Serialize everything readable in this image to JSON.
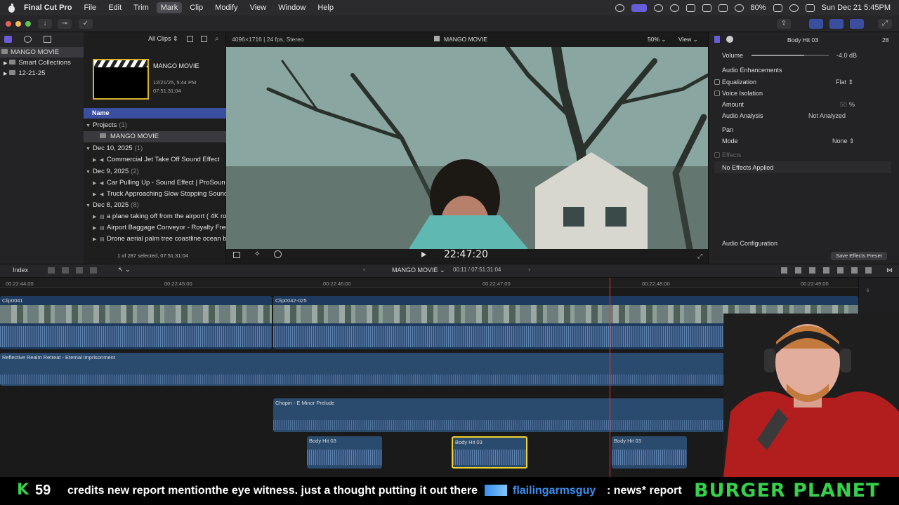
{
  "menubar": {
    "app": "Final Cut Pro",
    "items": [
      "File",
      "Edit",
      "Trim",
      "Mark",
      "Clip",
      "Modify",
      "View",
      "Window",
      "Help"
    ],
    "selected": "Mark",
    "battery": "80%",
    "datetime": "Sun Dec 21  5:45PM"
  },
  "library": {
    "items": [
      "MANGO MOVIE",
      "Smart Collections",
      "12-21-25"
    ]
  },
  "browser": {
    "filter": "All Clips",
    "project": {
      "title": "MANGO MOVIE",
      "date": "12/21/25, 5:44 PM",
      "duration": "07:51:31:04"
    },
    "col_header": "Name",
    "selection": "1 of 287 selected, 07:51:31:04",
    "groups": [
      {
        "label": "Projects",
        "count": "(1)",
        "items": [
          "MANGO MOVIE"
        ]
      },
      {
        "label": "Dec 10, 2025",
        "count": "(1)",
        "items": [
          "Commercial Jet Take Off Sound Effect"
        ]
      },
      {
        "label": "Dec 9, 2025",
        "count": "(2)",
        "items": [
          "Car Pulling Up - Sound Effect  |  ProSoun",
          "Truck Approaching Slow Stopping Sound"
        ]
      },
      {
        "label": "Dec 8, 2025",
        "count": "(8)",
        "items": [
          "a plane taking off from the airport ( 4K ro",
          "Airport Baggage Conveyor - Royalty Free",
          "Drone aerial palm tree coastline ocean be"
        ]
      }
    ]
  },
  "viewer": {
    "format": "4096×1716 | 24 fps, Stereo",
    "title": "MANGO MOVIE",
    "zoom": "50%",
    "view": "View",
    "timecode": "22:47:20"
  },
  "inspector": {
    "clip": "Body Hit 03",
    "time": "28",
    "volume_label": "Volume",
    "volume_value": "-4.0 dB",
    "volume_level": 0.68,
    "enh": "Audio Enhancements",
    "eq": "Equalization",
    "eq_val": "Flat",
    "vi": "Voice Isolation",
    "amount": "Amount",
    "amount_val": "50",
    "amount_unit": "%",
    "analysis": "Audio Analysis",
    "analysis_val": "Not Analyzed",
    "pan": "Pan",
    "mode": "Mode",
    "mode_val": "None",
    "effects": "Effects",
    "no_effects": "No Effects Applied",
    "config": "Audio Configuration",
    "save": "Save Effects Preset"
  },
  "timeline": {
    "index": "Index",
    "project": "MANGO MOVIE",
    "tc": "00:11 / 07:51:31:04",
    "ruler": [
      "00:22:44:00",
      "00:22:45:00",
      "00:22:46:00",
      "00:22:47:00",
      "00:22:48:00",
      "00:22:49:00"
    ],
    "clips": {
      "v1": "Clip0041",
      "v2": "Clip0042-025",
      "music1": "Reflective Realm Retreat - Eternal imprisonment",
      "music2": "Chopin - E Minor Prelude",
      "hit1": "Body Hit 03",
      "hit2": "Body Hit 03",
      "hit3": "Body Hit 03"
    },
    "meter_labels": [
      "6",
      "0",
      "-6"
    ]
  },
  "ticker": {
    "count": "59",
    "text": "credits new report mentionthe eye witness. just a thought putting it out there",
    "user": "flailingarmsguy",
    "msg": ": news* report",
    "brand": "BURGER PLANET"
  }
}
